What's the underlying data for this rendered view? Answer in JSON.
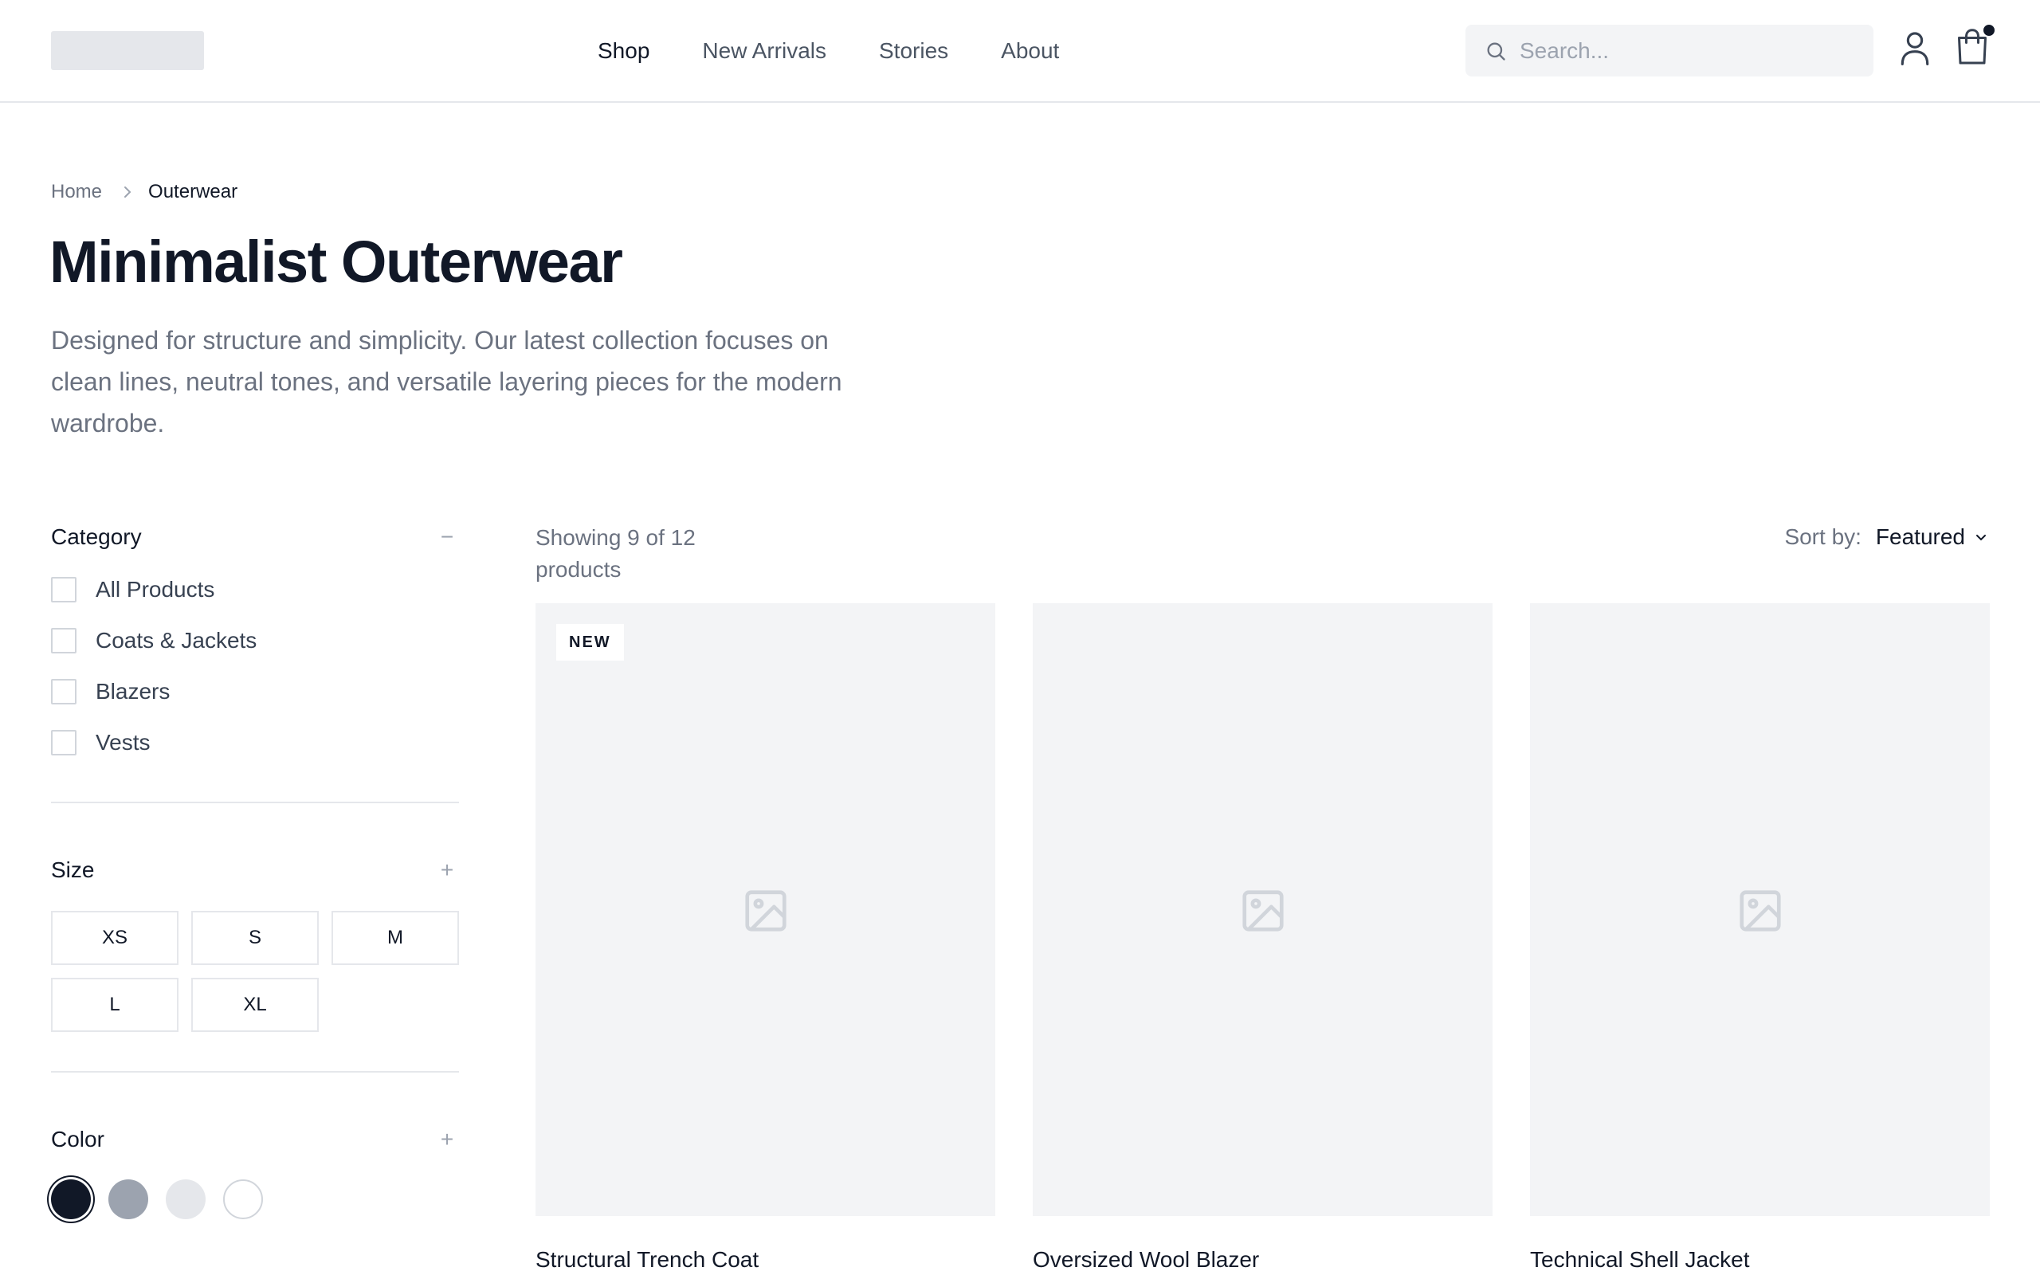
{
  "header": {
    "nav": [
      "Shop",
      "New Arrivals",
      "Stories",
      "About"
    ],
    "active_nav": "Shop",
    "search_placeholder": "Search...",
    "icons": [
      "search-icon",
      "user-icon",
      "cart-icon"
    ],
    "cart_has_items": true
  },
  "breadcrumb": {
    "home": "Home",
    "current": "Outerwear"
  },
  "hero": {
    "title": "Minimalist Outerwear",
    "description": "Designed for structure and simplicity. Our latest collection focuses on clean lines, neutral tones, and versatile layering pieces for the modern wardrobe."
  },
  "filters": {
    "category": {
      "label": "Category",
      "toggle": "−",
      "items": [
        "All Products",
        "Coats & Jackets",
        "Blazers",
        "Vests"
      ]
    },
    "size": {
      "label": "Size",
      "toggle": "+",
      "options": [
        "XS",
        "S",
        "M",
        "L",
        "XL"
      ]
    },
    "color": {
      "label": "Color",
      "toggle": "+",
      "swatches": [
        "#111827",
        "#9ca3af",
        "#e5e7eb",
        "#ffffff"
      ],
      "selected_index": 0
    }
  },
  "results": {
    "count_text": "Showing 9 of 12 products",
    "sort_label": "Sort by:",
    "sort_value": "Featured"
  },
  "products": [
    {
      "name": "Structural Trench Coat",
      "badge": "NEW"
    },
    {
      "name": "Oversized Wool Blazer",
      "badge": ""
    },
    {
      "name": "Technical Shell Jacket",
      "badge": ""
    }
  ],
  "colors": {
    "text_primary": "#111827",
    "text_secondary": "#6b7280",
    "border": "#e5e7eb",
    "image_placeholder": "#f3f4f6"
  }
}
